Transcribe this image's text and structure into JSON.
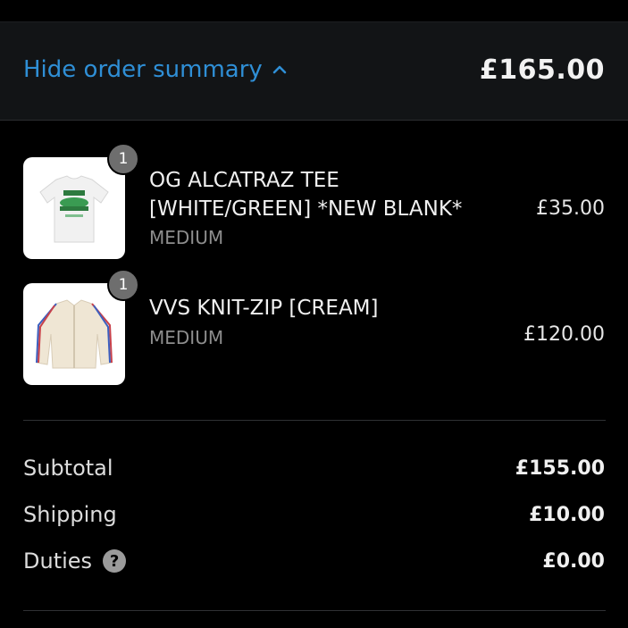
{
  "summary": {
    "toggle_label": "Hide order summary",
    "toggle_icon": "chevron-up-icon",
    "total": "£165.00",
    "accent_color": "#2f8fd6"
  },
  "items": [
    {
      "quantity": "1",
      "name_line1": "OG ALCATRAZ TEE",
      "name_line2": "[WHITE/GREEN] *NEW BLANK*",
      "variant": "MEDIUM",
      "price": "£35.00"
    },
    {
      "quantity": "1",
      "name_line1": "VVS KNIT-ZIP [CREAM]",
      "variant": "MEDIUM",
      "price": "£120.00"
    }
  ],
  "totals": {
    "subtotal_label": "Subtotal",
    "subtotal_value": "£155.00",
    "shipping_label": "Shipping",
    "shipping_value": "£10.00",
    "duties_label": "Duties",
    "duties_help_icon": "question-circle-icon",
    "duties_value": "£0.00"
  }
}
